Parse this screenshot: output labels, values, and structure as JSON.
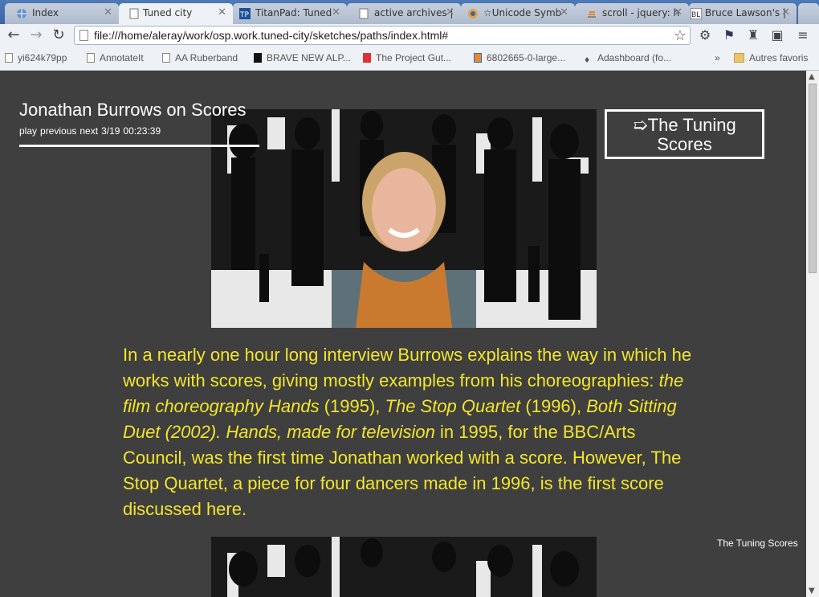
{
  "tabs": [
    {
      "label": "Index",
      "active": false
    },
    {
      "label": "Tuned city",
      "active": true
    },
    {
      "label": "TitanPad: Tuned",
      "active": false
    },
    {
      "label": "active archives |",
      "active": false
    },
    {
      "label": "☆Unicode Symb",
      "active": false
    },
    {
      "label": "scroll - jquery: h",
      "active": false
    },
    {
      "label": "Bruce Lawson's |",
      "active": false
    }
  ],
  "address_bar": {
    "url": "file:///home/aleray/work/osp.work.tuned-city/sketches/paths/index.html#"
  },
  "bookmarks": [
    "yi624k79pp",
    "AnnotateIt",
    "AA Ruberband",
    "BRAVE NEW ALP...",
    "The Project Gut...",
    "6802665-0-large...",
    "Adashboard (fo...",
    "Autres favoris"
  ],
  "page": {
    "title": "Jonathan Burrows on Scores",
    "meta": {
      "play": "play",
      "previous": "previous",
      "next": "next",
      "position": "3/19",
      "time": "00:23:39"
    },
    "tuning_box_label": "➯The Tuning Scores",
    "paragraph": {
      "p1": "In a nearly one hour long interview Burrows explains the way in which he works with scores, giving mostly examples from his choreographies: ",
      "i1": "the film choreography Hands",
      "p2": " (1995), ",
      "i2": "The Stop Quartet",
      "p3": " (1996), ",
      "i3": "Both Sitting Duet (2002). Hands, made for television",
      "p4": " in 1995, for the BBC/Arts Council, was the first time Jonathan worked with a score. However, The Stop Quartet, a piece for four dancers made in 1996, is the first score discussed here."
    },
    "footer_link": "The Tuning Scores"
  },
  "colors": {
    "background": "#3f3f3f",
    "accent_text": "#f3e62b",
    "text": "#ffffff"
  }
}
